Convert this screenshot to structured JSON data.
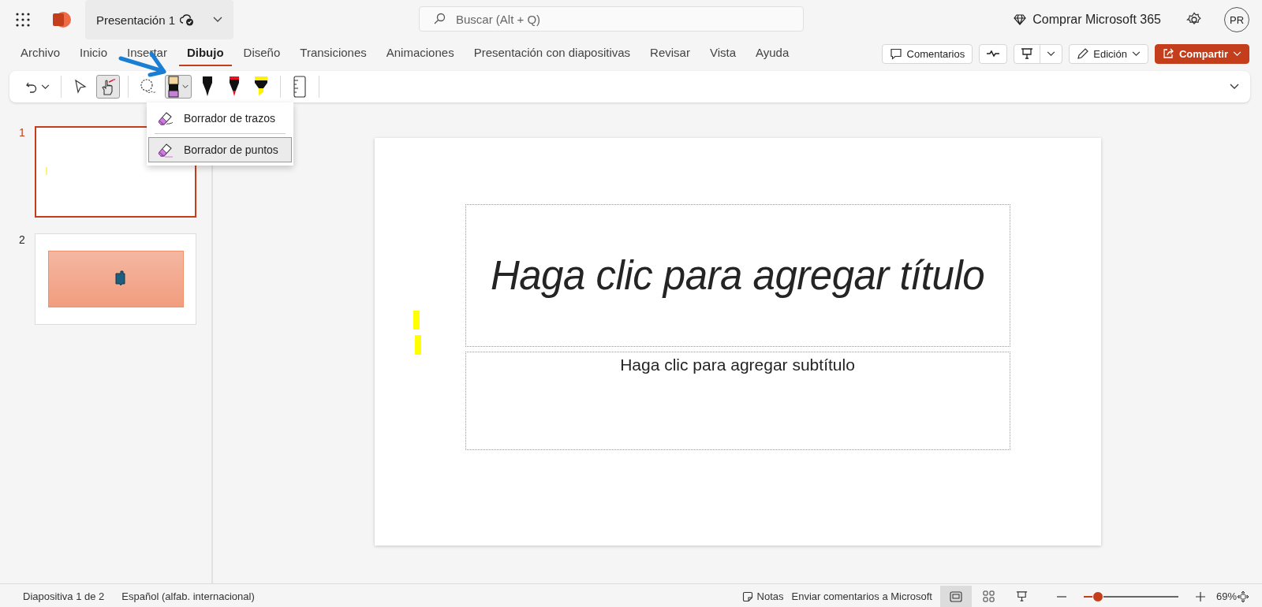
{
  "header": {
    "document_title": "Presentación 1",
    "search_placeholder": "Buscar (Alt + Q)",
    "buy_label": "Comprar Microsoft 365",
    "avatar_initials": "PR"
  },
  "ribbon_tabs": [
    {
      "label": "Archivo",
      "selected": false
    },
    {
      "label": "Inicio",
      "selected": false
    },
    {
      "label": "Insertar",
      "selected": false
    },
    {
      "label": "Dibujo",
      "selected": true
    },
    {
      "label": "Diseño",
      "selected": false
    },
    {
      "label": "Transiciones",
      "selected": false
    },
    {
      "label": "Animaciones",
      "selected": false
    },
    {
      "label": "Presentación con diapositivas",
      "selected": false
    },
    {
      "label": "Revisar",
      "selected": false
    },
    {
      "label": "Vista",
      "selected": false
    },
    {
      "label": "Ayuda",
      "selected": false
    }
  ],
  "actions": {
    "comments": "Comentarios",
    "editing": "Edición",
    "share": "Compartir"
  },
  "tools": [
    {
      "kind": "undo",
      "selected": false
    },
    {
      "kind": "divider"
    },
    {
      "kind": "select",
      "selected": false
    },
    {
      "kind": "touch",
      "selected": true
    },
    {
      "kind": "divider"
    },
    {
      "kind": "lasso",
      "selected": false
    },
    {
      "kind": "eraser",
      "selected": true
    },
    {
      "kind": "pen",
      "color": "#111111",
      "selected": false
    },
    {
      "kind": "pen",
      "color": "#e81123",
      "selected": false
    },
    {
      "kind": "highlighter",
      "color": "#fff100",
      "selected": false
    },
    {
      "kind": "divider"
    },
    {
      "kind": "ruler",
      "selected": false
    },
    {
      "kind": "divider"
    }
  ],
  "eraser_menu": [
    {
      "label": "Borrador de trazos",
      "selected": false
    },
    {
      "label": "Borrador de puntos",
      "selected": true
    }
  ],
  "slides": [
    {
      "number": "1",
      "selected": true,
      "kind": "blank"
    },
    {
      "number": "2",
      "selected": false,
      "kind": "shape"
    }
  ],
  "slide": {
    "title_placeholder": "Haga clic para agregar título",
    "subtitle_placeholder": "Haga clic para agregar subtítulo"
  },
  "status_bar": {
    "slide_position": "Diapositiva 1 de 2",
    "language": "Español (alfab. internacional)",
    "notes": "Notas",
    "feedback": "Enviar comentarios a Microsoft",
    "views": [
      {
        "kind": "normal",
        "selected": true
      },
      {
        "kind": "sorter",
        "selected": false
      },
      {
        "kind": "reading",
        "selected": false
      }
    ],
    "zoom": {
      "level": 0.15,
      "reading": "69%"
    }
  }
}
